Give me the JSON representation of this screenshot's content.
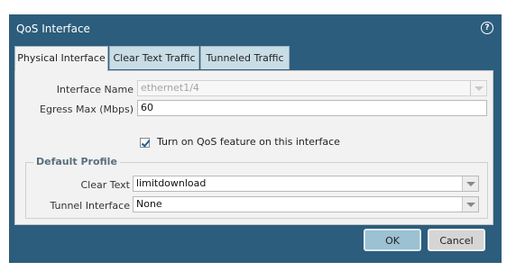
{
  "dialog": {
    "title": "QoS Interface",
    "help_icon": "help-circle-icon"
  },
  "tabs": [
    {
      "label": "Physical Interface",
      "active": true
    },
    {
      "label": "Clear Text Traffic",
      "active": false
    },
    {
      "label": "Tunneled Traffic",
      "active": false
    }
  ],
  "form": {
    "interface_name": {
      "label": "Interface Name",
      "value": "ethernet1/4"
    },
    "egress_max": {
      "label": "Egress Max (Mbps)",
      "value": "60"
    },
    "qos_checkbox": {
      "label": "Turn on QoS feature on this interface",
      "checked": true
    }
  },
  "default_profile": {
    "legend": "Default Profile",
    "clear_text": {
      "label": "Clear Text",
      "value": "limitdownload"
    },
    "tunnel_interface": {
      "label": "Tunnel Interface",
      "value": "None"
    }
  },
  "buttons": {
    "ok": "OK",
    "cancel": "Cancel"
  },
  "colors": {
    "dialog_bg": "#2c5d7c",
    "panel_bg": "#f2f2f2",
    "ok_button": "#9cc1d2"
  }
}
